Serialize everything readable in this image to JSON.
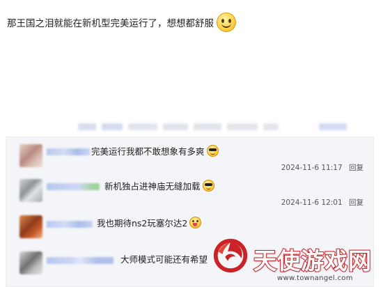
{
  "post": {
    "text": "那王国之泪就能在新机型完美运行了，想想都舒服",
    "emoji": "smiley-face-icon"
  },
  "colors": {
    "comment_bg": "#f4f5f8",
    "username_blur": "#b7c7ee",
    "watermark_red": "#cc2127"
  },
  "comments": [
    {
      "text": "完美运行我都不敢想象有多爽",
      "emoji": "cool-sunglasses-emoji-icon",
      "time": "2024-11-6 11:17",
      "reply": "回复"
    },
    {
      "text": "新机独占进神庙无缝加载",
      "emoji": "cool-sunglasses-emoji-icon",
      "time": "2024-11-6 12:01",
      "reply": "回复"
    },
    {
      "text": "我也期待ns2玩塞尔达2",
      "emoji": "wink-tongue-emoji-icon",
      "time": "",
      "reply": ""
    },
    {
      "text": "大师模式可能还有希望",
      "emoji": "",
      "time": "",
      "reply": ""
    }
  ],
  "watermark": {
    "title": "天使游戏网",
    "url": "www.townangel.com",
    "logo": "phoenix-logo-icon"
  }
}
